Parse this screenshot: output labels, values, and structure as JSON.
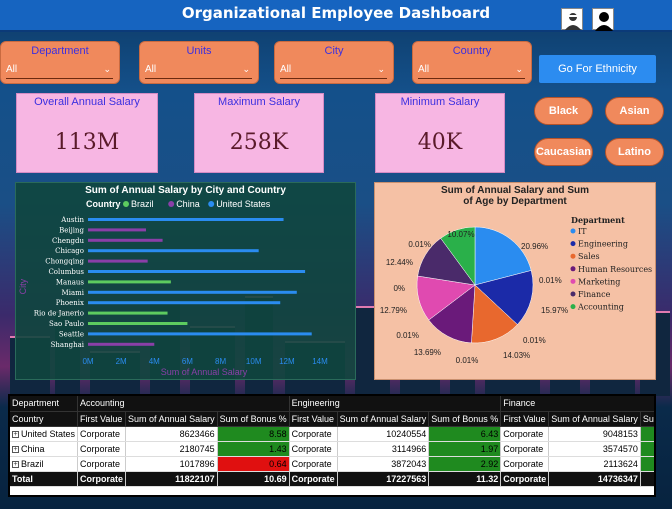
{
  "header": {
    "title": "Organizational Employee Dashboard",
    "icons": [
      "user-icon",
      "user-silhouette-icon"
    ]
  },
  "slicers": [
    {
      "label": "Department",
      "value": "All"
    },
    {
      "label": "Units",
      "value": "All"
    },
    {
      "label": "City",
      "value": "All"
    },
    {
      "label": "Country",
      "value": "All"
    }
  ],
  "ethnicity": {
    "button_label": "Go For Ethnicity",
    "options": [
      "Black",
      "Asian",
      "Caucasian",
      "Latino"
    ]
  },
  "kpis": [
    {
      "title": "Overall Annual Salary",
      "value": "113M"
    },
    {
      "title": "Maximum Salary",
      "value": "258K"
    },
    {
      "title": "Minimum Salary",
      "value": "40K"
    }
  ],
  "colors": {
    "brazil": "#5dcb5f",
    "china": "#8a3fa8",
    "us": "#2a8cf0",
    "title_blue": "#3b2fe0",
    "slicer_orange": "#f0895c",
    "kpi_pink": "#f7b6e3"
  },
  "chart_data": [
    {
      "type": "bar",
      "orientation": "horizontal",
      "title": "Sum of Annual Salary by City and Country",
      "xlabel": "Sum of Annual Salary",
      "ylabel": "City",
      "legend_title": "Country",
      "legend_position": "top",
      "categories": [
        "Austin",
        "Beijing",
        "Chengdu",
        "Chicago",
        "Chongqing",
        "Columbus",
        "Manaus",
        "Miami",
        "Phoenix",
        "Rio de Janerio",
        "Sao Paulo",
        "Seattle",
        "Shanghai"
      ],
      "x_ticks": [
        "0M",
        "2M",
        "4M",
        "6M",
        "8M",
        "10M",
        "12M",
        "14M"
      ],
      "xlim": [
        0,
        14
      ],
      "series": [
        {
          "name": "Brazil",
          "values": [
            null,
            null,
            null,
            null,
            null,
            null,
            5.0,
            null,
            null,
            4.8,
            6.0,
            null,
            null
          ]
        },
        {
          "name": "China",
          "values": [
            null,
            3.5,
            4.5,
            null,
            3.6,
            null,
            null,
            null,
            null,
            null,
            null,
            null,
            4.0
          ]
        },
        {
          "name": "United States",
          "values": [
            11.8,
            null,
            null,
            10.3,
            null,
            13.1,
            null,
            12.6,
            11.6,
            null,
            null,
            13.5,
            null
          ]
        }
      ]
    },
    {
      "type": "pie",
      "title": "Sum of Annual Salary and Sum of Age by Department",
      "legend_title": "Department",
      "legend_position": "right",
      "categories": [
        "IT",
        "Engineering",
        "Sales",
        "Human Resources",
        "Marketing",
        "Finance",
        "Accounting"
      ],
      "slice_labels": [
        "20.96%",
        "0.01%",
        "15.97%",
        "0.01%",
        "14.03%",
        "0.01%",
        "13.69%",
        "0.01%",
        "12.79%",
        "0%",
        "12.44%",
        "0.01%",
        "10.07%"
      ],
      "values": [
        20.96,
        15.97,
        14.03,
        13.69,
        12.79,
        12.44,
        10.07
      ],
      "colors": [
        "#2a8cf0",
        "#1b2aa8",
        "#e8682e",
        "#6a1a7a",
        "#e04ab0",
        "#4a2a6a",
        "#2ab04a"
      ]
    }
  ],
  "table": {
    "headers_row1": [
      "Department",
      "Accounting",
      "Engineering",
      "Finance"
    ],
    "headers_row2": [
      "Country",
      "First Value",
      "Sum of Annual Salary",
      "Sum of Bonus %",
      "First Value",
      "Sum of Annual Salary",
      "Sum of Bonus %",
      "First Value",
      "Sum of Annual Salary",
      "Sum o"
    ],
    "rows": [
      {
        "country": "United States",
        "a_fv": "Corporate",
        "a_sal": "8623466",
        "a_bon": "8.58",
        "e_fv": "Corporate",
        "e_sal": "10240554",
        "e_bon": "6.43",
        "f_fv": "Corporate",
        "f_sal": "9048153"
      },
      {
        "country": "China",
        "a_fv": "Corporate",
        "a_sal": "2180745",
        "a_bon": "1.43",
        "e_fv": "Corporate",
        "e_sal": "3114966",
        "e_bon": "1.97",
        "f_fv": "Corporate",
        "f_sal": "3574570"
      },
      {
        "country": "Brazil",
        "a_fv": "Corporate",
        "a_sal": "1017896",
        "a_bon": "0.64",
        "e_fv": "Corporate",
        "e_sal": "3872043",
        "e_bon": "2.92",
        "f_fv": "Corporate",
        "f_sal": "2113624"
      }
    ],
    "total": {
      "label": "Total",
      "a_fv": "Corporate",
      "a_sal": "11822107",
      "a_bon": "10.69",
      "e_fv": "Corporate",
      "e_sal": "17227563",
      "e_bon": "11.32",
      "f_fv": "Corporate",
      "f_sal": "14736347"
    }
  }
}
